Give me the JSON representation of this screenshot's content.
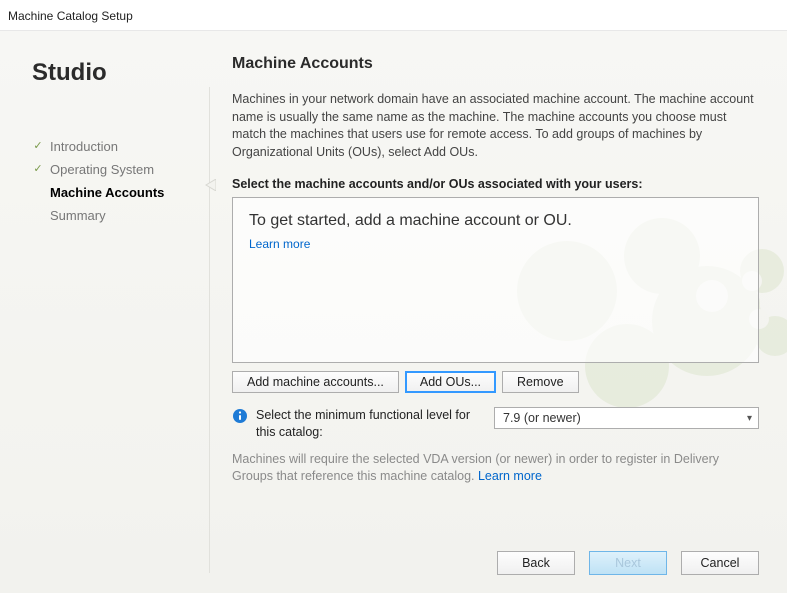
{
  "window": {
    "title": "Machine Catalog Setup"
  },
  "sidebar": {
    "brand": "Studio",
    "steps": [
      {
        "label": "Introduction",
        "state": "completed"
      },
      {
        "label": "Operating System",
        "state": "completed"
      },
      {
        "label": "Machine Accounts",
        "state": "current"
      },
      {
        "label": "Summary",
        "state": "pending"
      }
    ]
  },
  "main": {
    "title": "Machine Accounts",
    "intro": "Machines in your network domain have an associated machine account. The machine account name is usually the same name as the machine. The machine accounts you choose must match the machines that users use for remote access. To add groups of machines by Organizational Units (OUs), select Add OUs.",
    "select_label": "Select the machine accounts and/or OUs associated with your users:",
    "empty_headline": "To get started, add a machine account or OU.",
    "learn_more": "Learn more",
    "buttons": {
      "add_accounts": "Add machine accounts...",
      "add_ous": "Add OUs...",
      "remove": "Remove"
    },
    "functional_level": {
      "label": "Select the minimum functional level for this catalog:",
      "selected": "7.9 (or newer)"
    },
    "note_prefix": "Machines will require the selected VDA version (or newer) in order to register in Delivery Groups that reference this machine catalog. ",
    "note_link": "Learn more"
  },
  "footer": {
    "back": "Back",
    "next": "Next",
    "cancel": "Cancel"
  }
}
